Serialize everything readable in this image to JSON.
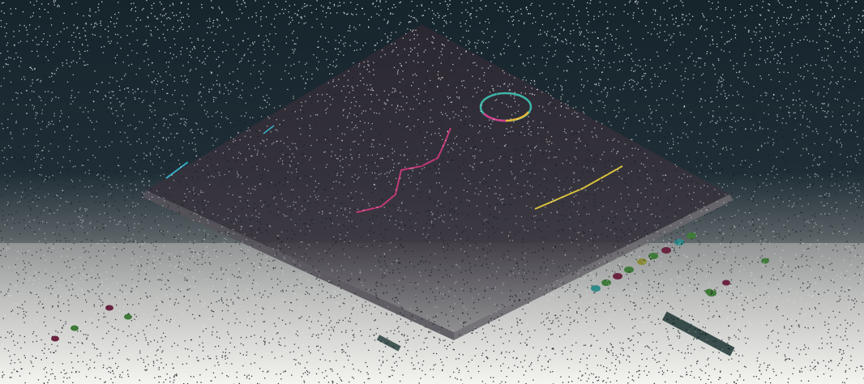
{
  "colors": {
    "sky_top": "#18262e",
    "sky_mid": "#213038",
    "ground": "#f2f2ee",
    "panel_dark": "#2a2630",
    "panel_edge": "#3a3440",
    "ring_teal": "#3fb6a8",
    "ring_pink": "#d23c8c",
    "ring_yellow": "#e5b83a",
    "line_magenta": "#c23a78",
    "line_yellow": "#d8c23a",
    "line_cyan": "#3ab0c8",
    "dot_green": "#3f7a3a",
    "dot_maroon": "#6a2440",
    "dot_teal": "#2f7a7a",
    "noise_light": "#ffffff",
    "noise_dark": "#0c1216"
  },
  "legend_dots": [
    {
      "color": "#3f7a3a"
    },
    {
      "color": "#2f8a8a"
    },
    {
      "color": "#6a2440"
    },
    {
      "color": "#3f7a3a"
    },
    {
      "color": "#8a8a3a"
    },
    {
      "color": "#3f7a3a"
    },
    {
      "color": "#6a2440"
    },
    {
      "color": "#3f7a3a"
    },
    {
      "color": "#2f8a8a"
    },
    {
      "color": "#3f7a3a"
    }
  ]
}
